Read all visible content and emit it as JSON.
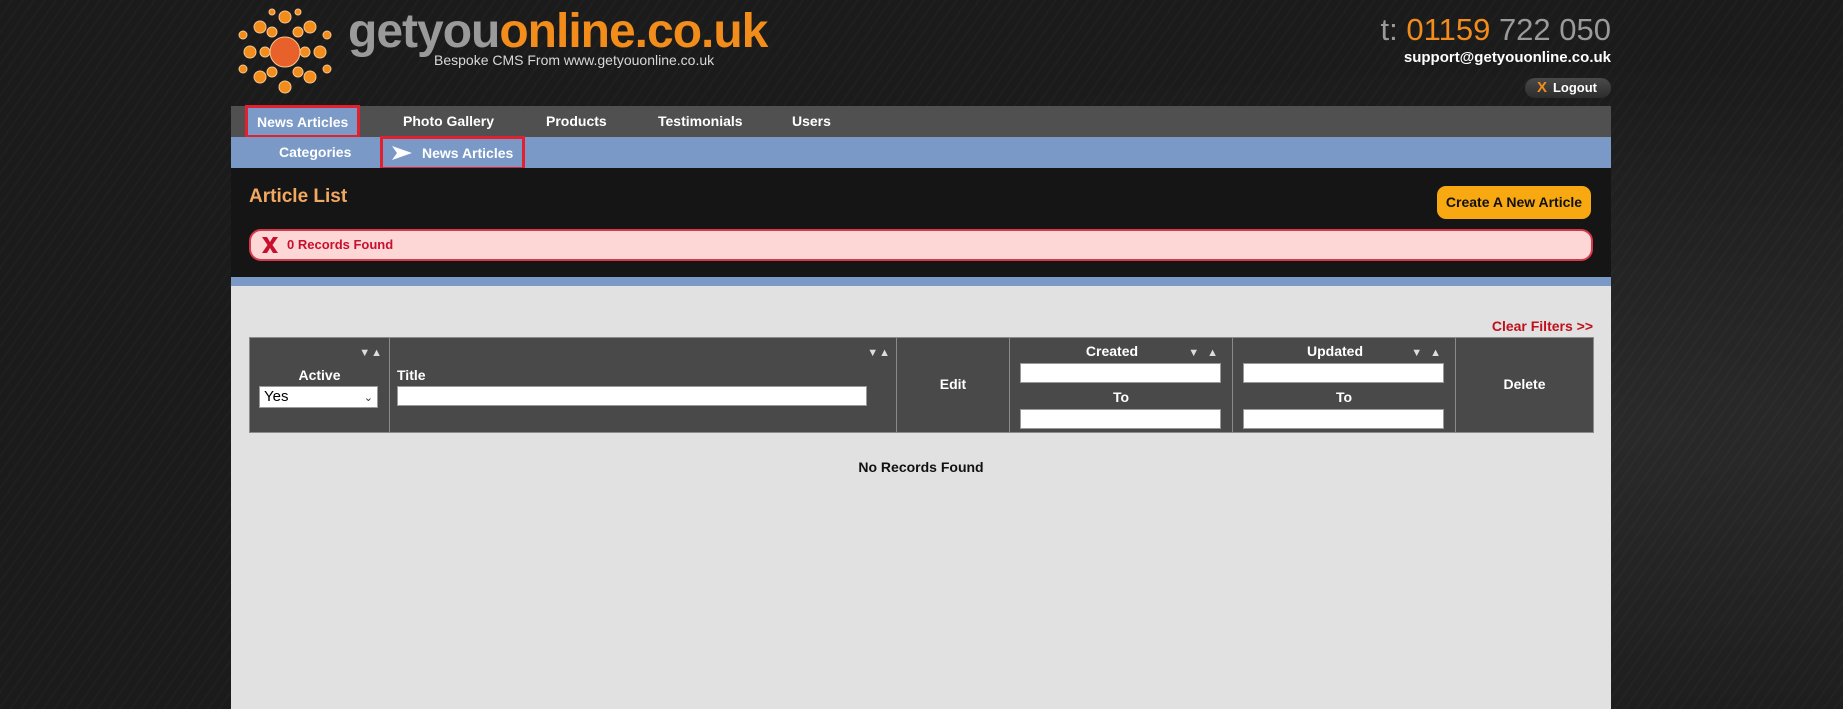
{
  "header": {
    "logo_part1": "getyou",
    "logo_part2": "online.co.uk",
    "tagline": "Bespoke CMS From www.getyouonline.co.uk",
    "phone_prefix": "t:",
    "phone_a": "01159",
    "phone_b": "722 050",
    "email": "support@getyouonline.co.uk",
    "logout_icon": "X",
    "logout_label": "Logout"
  },
  "nav": {
    "items": [
      {
        "label": "News Articles",
        "active": true
      },
      {
        "label": "Photo Gallery"
      },
      {
        "label": "Products"
      },
      {
        "label": "Testimonials"
      },
      {
        "label": "Users"
      }
    ]
  },
  "subnav": {
    "items": [
      {
        "label": "Categories"
      },
      {
        "label": "News Articles",
        "active": true,
        "icon": "arrow-right-icon"
      }
    ]
  },
  "page": {
    "title": "Article List",
    "create_button": "Create A New Article",
    "alert_message": "0 Records Found",
    "clear_filters": "Clear Filters >>"
  },
  "table": {
    "columns": {
      "active": "Active",
      "title": "Title",
      "edit": "Edit",
      "created": "Created",
      "created_to": "To",
      "updated": "Updated",
      "updated_to": "To",
      "delete": "Delete"
    },
    "active_filter_value": "Yes",
    "sort_glyph": "▼▲",
    "empty_message": "No Records Found"
  },
  "colors": {
    "accent_orange": "#f28c1a",
    "nav_blue": "#7a99c7",
    "highlight_red": "#e12030",
    "create_button": "#f8a810"
  }
}
